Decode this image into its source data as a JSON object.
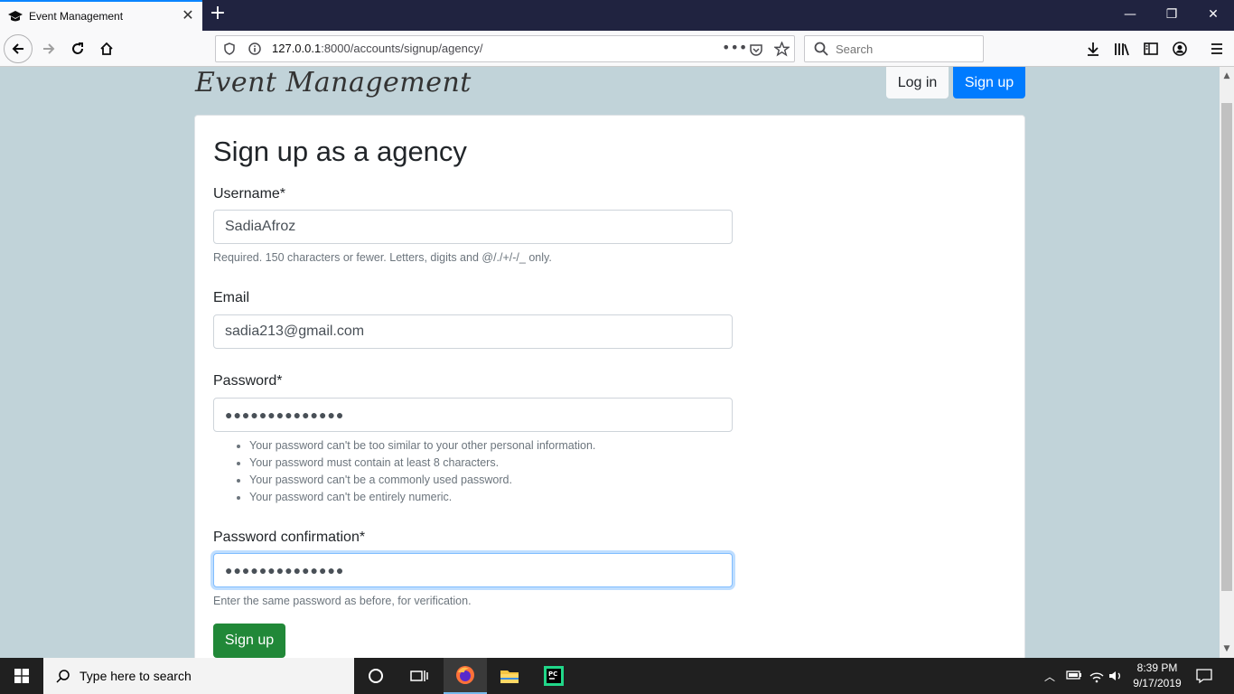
{
  "browser": {
    "tab_title": "Event Management",
    "url_host": "127.0.0.1",
    "url_rest": ":8000/accounts/signup/agency/",
    "search_placeholder": "Search"
  },
  "site": {
    "brand": "Event Management",
    "nav_login": "Log in",
    "nav_signup": "Sign up"
  },
  "form": {
    "title": "Sign up as a agency",
    "username_label": "Username*",
    "username_value": "SadiaAfroz",
    "username_help": "Required. 150 characters or fewer. Letters, digits and @/./+/-/_ only.",
    "email_label": "Email",
    "email_value": "sadia213@gmail.com",
    "password_label": "Password*",
    "password_value": "●●●●●●●●●●●●●●",
    "password_help": [
      "Your password can't be too similar to your other personal information.",
      "Your password must contain at least 8 characters.",
      "Your password can't be a commonly used password.",
      "Your password can't be entirely numeric."
    ],
    "password2_label": "Password confirmation*",
    "password2_value": "●●●●●●●●●●●●●●",
    "password2_help": "Enter the same password as before, for verification.",
    "submit_label": "Sign up"
  },
  "taskbar": {
    "search_text": "Type here to search",
    "time": "8:39 PM",
    "date": "9/17/2019"
  },
  "colors": {
    "page_bg": "#c1d3d9",
    "primary": "#007bff",
    "success": "#218838"
  }
}
